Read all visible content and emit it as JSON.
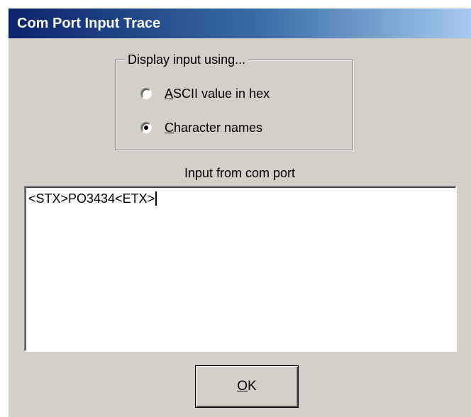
{
  "window": {
    "title": "Com Port Input Trace"
  },
  "display_group": {
    "legend": "Display input using...",
    "options": [
      {
        "label_mnemonic": "A",
        "label_rest": "SCII value in hex",
        "selected": false
      },
      {
        "label_mnemonic": "C",
        "label_rest": "haracter names",
        "selected": true
      }
    ]
  },
  "input_field": {
    "label": "Input from com port",
    "value": "<STX>PO3434<ETX>"
  },
  "buttons": {
    "ok_mnemonic": "O",
    "ok_rest": "K"
  },
  "colors": {
    "dialog_bg": "#d4d0c8",
    "title_gradient_start": "#0a246a",
    "title_gradient_end": "#a6caf0"
  }
}
